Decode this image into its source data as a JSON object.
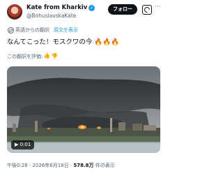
{
  "author": {
    "name": "Kate from Kharkiv",
    "handle": "@BohuslavskaKate",
    "verified_icon": "verified-badge-icon"
  },
  "actions": {
    "follow_label": "フォロー",
    "grok_icon": "grok-icon",
    "more_label": "···"
  },
  "translation": {
    "translated_from": "英語からの翻訳",
    "show_original": "原文を表示",
    "icon": "translate-icon"
  },
  "tweet": {
    "text": "なんてこった！モスクワの今 🔥🔥🔥"
  },
  "rating": {
    "label": "この翻訳を評価:",
    "thumb_up": "👍",
    "thumb_down": "👎"
  },
  "video": {
    "play_icon": "▶",
    "time": "0:01"
  },
  "meta": {
    "time": "午後0:28",
    "separator": "·",
    "date": "2026年6月18日",
    "views_count": "578.8万",
    "views_label": " 件の表示"
  },
  "colors": {
    "accent": "#1d9bf0",
    "text": "#0f1419",
    "muted": "#536471"
  }
}
